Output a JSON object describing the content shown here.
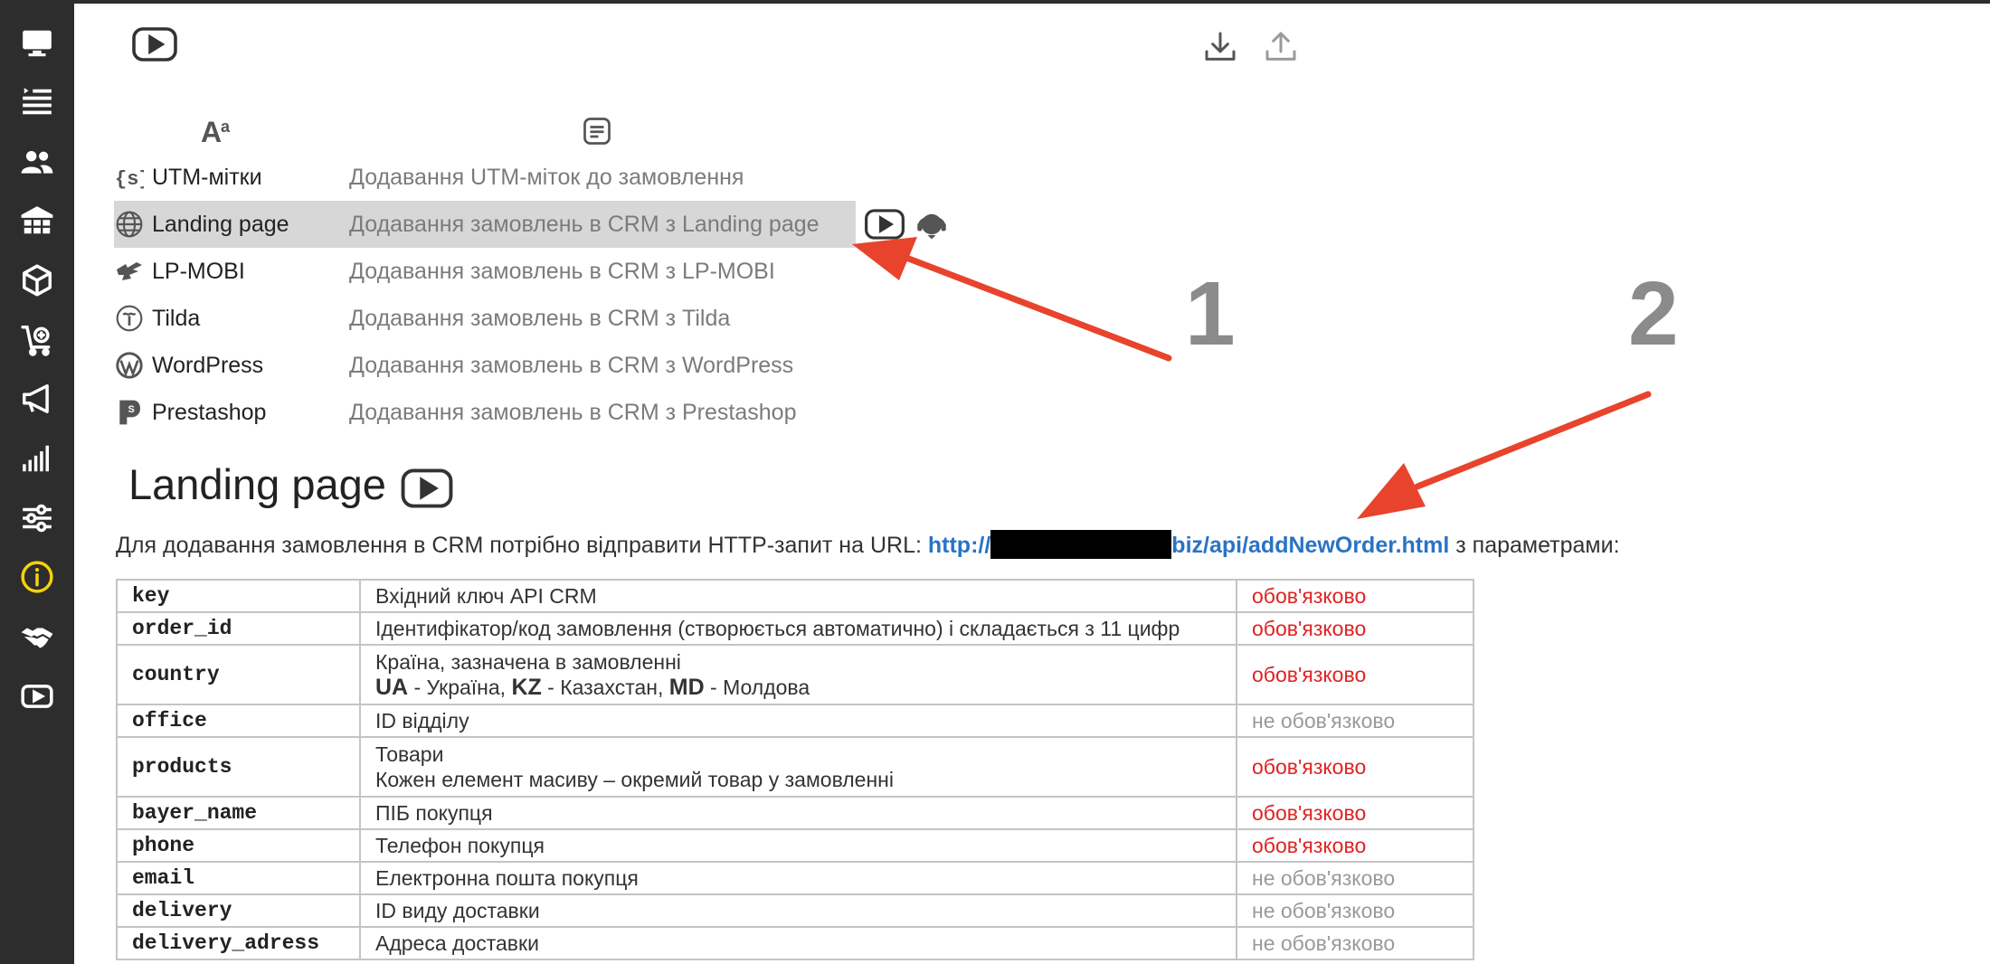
{
  "sidebar": {
    "items": [
      {
        "icon": "monitor-icon"
      },
      {
        "icon": "orders-list-icon"
      },
      {
        "icon": "users-icon"
      },
      {
        "icon": "warehouse-icon"
      },
      {
        "icon": "box-icon"
      },
      {
        "icon": "cart-icon"
      },
      {
        "icon": "megaphone-icon"
      },
      {
        "icon": "stats-icon"
      },
      {
        "icon": "sliders-icon"
      },
      {
        "icon": "info-icon"
      },
      {
        "icon": "handshake-icon"
      },
      {
        "icon": "video-icon"
      }
    ],
    "active_index": 9,
    "active_color": "#f5d20b"
  },
  "integrations": [
    {
      "icon": "utm-icon",
      "name": "UTM-мітки",
      "desc": "Додавання UTM-міток до замовлення"
    },
    {
      "icon": "globe-icon",
      "name": "Landing page",
      "desc": "Додавання замовлень в CRM з Landing page"
    },
    {
      "icon": "lpmobi-icon",
      "name": "LP-MOBI",
      "desc": "Додавання замовлень в CRM з LP-MOBI"
    },
    {
      "icon": "tilda-icon",
      "name": "Tilda",
      "desc": "Додавання замовлень в CRM з Tilda"
    },
    {
      "icon": "wordpress-icon",
      "name": "WordPress",
      "desc": "Додавання замовлень в CRM з WordPress"
    },
    {
      "icon": "prestashop-icon",
      "name": "Prestashop",
      "desc": "Додавання замовлень в CRM з Prestashop"
    }
  ],
  "section": {
    "title": "Landing page",
    "desc_prefix": "Для додавання замовлення в CRM потрібно відправити HTTP-запит на URL: ",
    "url_start": "http://",
    "url_end": "biz/api/addNewOrder.html",
    "desc_suffix": " з параметрами:"
  },
  "params": [
    {
      "name": "key",
      "desc": [
        "Вхідний ключ API CRM"
      ],
      "req": "обов'язково",
      "required": true
    },
    {
      "name": "order_id",
      "desc": [
        "Ідентифікатор/код замовлення (створюється автоматично) і складається з 11 цифр"
      ],
      "req": "обов'язково",
      "required": true
    },
    {
      "name": "country",
      "desc": [
        "Країна, зазначена в замовленні"
      ],
      "codes": [
        {
          "code": "UA",
          "label": " - Україна, "
        },
        {
          "code": "KZ",
          "label": " - Казахстан, "
        },
        {
          "code": "MD",
          "label": " - Молдова"
        }
      ],
      "req": "обов'язково",
      "required": true
    },
    {
      "name": "office",
      "desc": [
        "ID відділу"
      ],
      "req": "не обов'язково",
      "required": false
    },
    {
      "name": "products",
      "desc": [
        "Товари",
        "Кожен елемент масиву – окремий товар у замовленні"
      ],
      "req": "обов'язково",
      "required": true
    },
    {
      "name": "bayer_name",
      "desc": [
        "ПІБ покупця"
      ],
      "req": "обов'язково",
      "required": true
    },
    {
      "name": "phone",
      "desc": [
        "Телефон покупця"
      ],
      "req": "обов'язково",
      "required": true
    },
    {
      "name": "email",
      "desc": [
        "Електронна пошта покупця"
      ],
      "req": "не обов'язково",
      "required": false
    },
    {
      "name": "delivery",
      "desc": [
        "ID виду доставки"
      ],
      "req": "не обов'язково",
      "required": false
    },
    {
      "name": "delivery_adress",
      "desc": [
        "Адреса доставки"
      ],
      "req": "не обов'язково",
      "required": false
    }
  ],
  "annotations": {
    "marker1": "1",
    "marker2": "2",
    "arrow_color": "#e8432c"
  },
  "colors": {
    "sidebar_bg": "#2d2d2d",
    "selected_row": "#d7d7d7",
    "link": "#2a73c4",
    "required": "#e02222",
    "optional": "#9a9a9a"
  }
}
